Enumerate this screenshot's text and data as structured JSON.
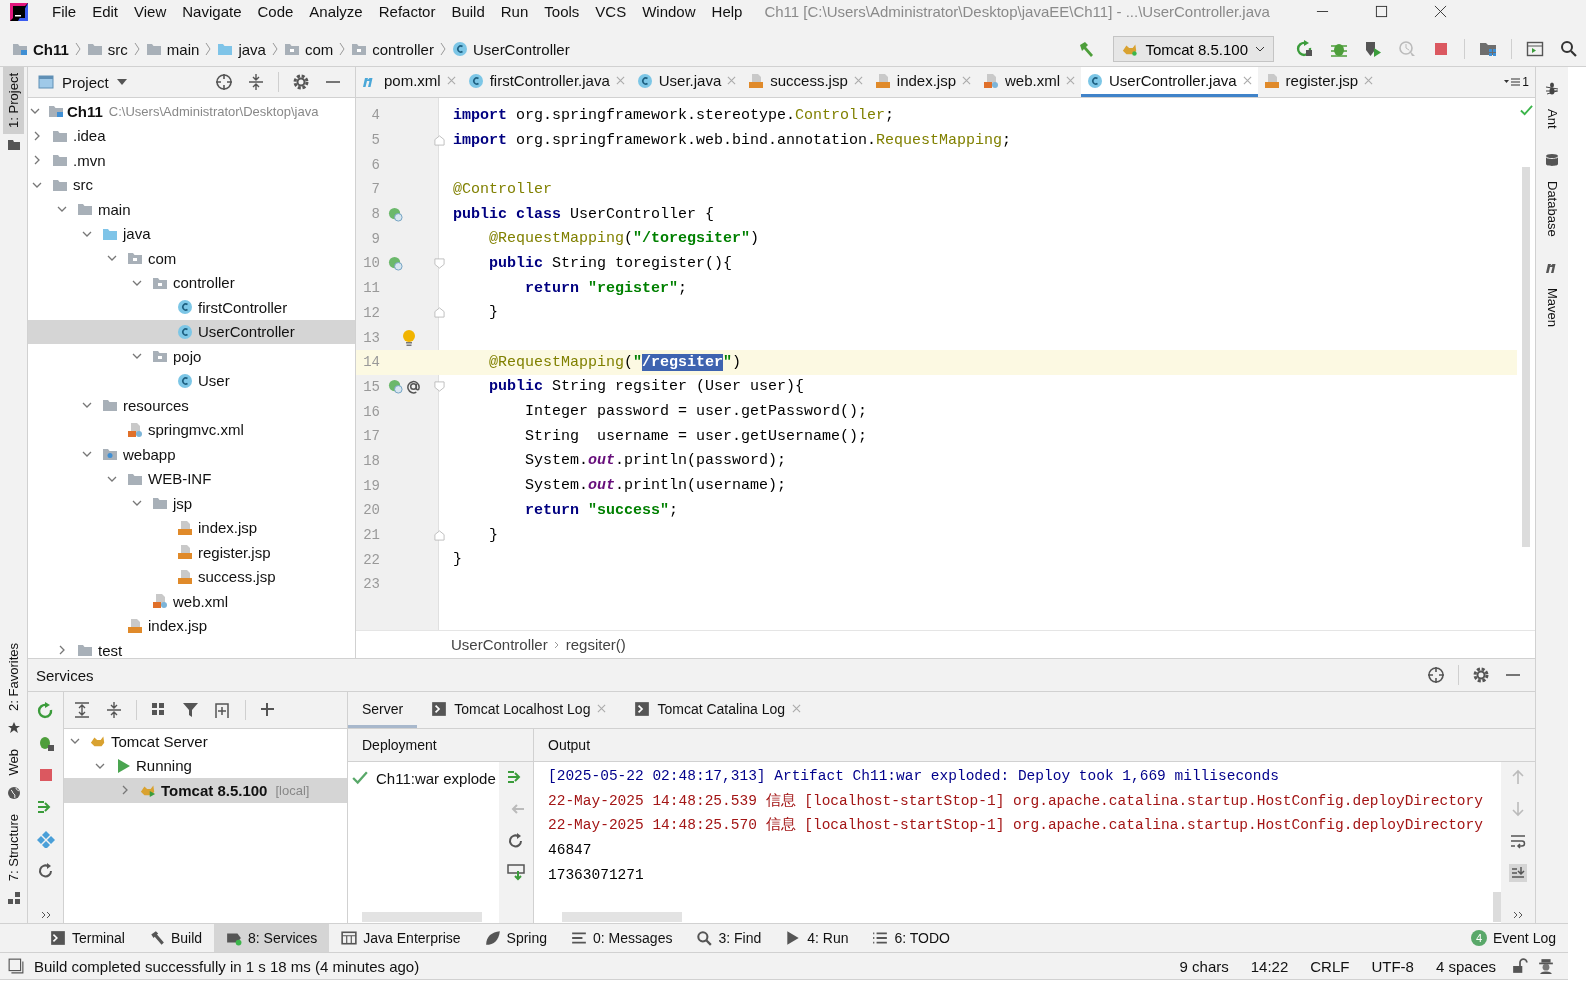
{
  "window": {
    "title": "Ch11 [C:\\Users\\Administrator\\Desktop\\javaEE\\Ch11] - ...\\UserController.java"
  },
  "menu": [
    "File",
    "Edit",
    "View",
    "Navigate",
    "Code",
    "Analyze",
    "Refactor",
    "Build",
    "Run",
    "Tools",
    "VCS",
    "Window",
    "Help"
  ],
  "breadcrumb": [
    {
      "label": "Ch11",
      "kind": "module"
    },
    {
      "label": "src",
      "kind": "folder"
    },
    {
      "label": "main",
      "kind": "folder"
    },
    {
      "label": "java",
      "kind": "srcfolder"
    },
    {
      "label": "com",
      "kind": "pkg"
    },
    {
      "label": "controller",
      "kind": "pkg"
    },
    {
      "label": "UserController",
      "kind": "class"
    }
  ],
  "run_config": {
    "label": "Tomcat 8.5.100"
  },
  "left_strip": [
    {
      "label": "1: Project",
      "selected": true
    },
    {
      "label": "2: Favorites",
      "selected": false
    },
    {
      "label": "Web",
      "selected": false
    },
    {
      "label": "7: Structure",
      "selected": false
    }
  ],
  "right_strip": [
    "Ant",
    "Database",
    "Maven"
  ],
  "project": {
    "title": "Project",
    "tree": [
      {
        "label": "Ch11",
        "kind": "module",
        "path": "C:\\Users\\Administrator\\Desktop\\java",
        "expanded": true,
        "selected": false,
        "children": [
          {
            "label": ".idea",
            "kind": "folder",
            "expanded": false,
            "selected": false
          },
          {
            "label": ".mvn",
            "kind": "folder",
            "expanded": false,
            "selected": false
          },
          {
            "label": "src",
            "kind": "folder",
            "expanded": true,
            "selected": false,
            "children": [
              {
                "label": "main",
                "kind": "folder",
                "expanded": true,
                "selected": false,
                "children": [
                  {
                    "label": "java",
                    "kind": "srcfolder",
                    "expanded": true,
                    "selected": false,
                    "children": [
                      {
                        "label": "com",
                        "kind": "pkg",
                        "expanded": true,
                        "selected": false,
                        "children": [
                          {
                            "label": "controller",
                            "kind": "pkg",
                            "expanded": true,
                            "selected": false,
                            "children": [
                              {
                                "label": "firstController",
                                "kind": "class",
                                "selected": false
                              },
                              {
                                "label": "UserController",
                                "kind": "class",
                                "selected": true
                              }
                            ]
                          },
                          {
                            "label": "pojo",
                            "kind": "pkg",
                            "expanded": true,
                            "selected": false,
                            "children": [
                              {
                                "label": "User",
                                "kind": "class",
                                "selected": false
                              }
                            ]
                          }
                        ]
                      }
                    ]
                  },
                  {
                    "label": "resources",
                    "kind": "folder",
                    "expanded": true,
                    "selected": false,
                    "children": [
                      {
                        "label": "springmvc.xml",
                        "kind": "xml",
                        "selected": false
                      }
                    ]
                  },
                  {
                    "label": "webapp",
                    "kind": "webfolder",
                    "expanded": true,
                    "selected": false,
                    "children": [
                      {
                        "label": "WEB-INF",
                        "kind": "folder",
                        "expanded": true,
                        "selected": false,
                        "children": [
                          {
                            "label": "jsp",
                            "kind": "folder",
                            "expanded": true,
                            "selected": false,
                            "children": [
                              {
                                "label": "index.jsp",
                                "kind": "jsp",
                                "selected": false
                              },
                              {
                                "label": "register.jsp",
                                "kind": "jsp",
                                "selected": false
                              },
                              {
                                "label": "success.jsp",
                                "kind": "jsp",
                                "selected": false
                              }
                            ]
                          },
                          {
                            "label": "web.xml",
                            "kind": "xml",
                            "selected": false
                          }
                        ]
                      },
                      {
                        "label": "index.jsp",
                        "kind": "jsp",
                        "selected": false
                      }
                    ]
                  }
                ]
              },
              {
                "label": "test",
                "kind": "folder",
                "expanded": false,
                "selected": false
              }
            ]
          }
        ]
      }
    ]
  },
  "editor": {
    "tabs": [
      {
        "label": "pom.xml",
        "kind": "maven",
        "selected": false
      },
      {
        "label": "firstController.java",
        "kind": "class",
        "selected": false
      },
      {
        "label": "User.java",
        "kind": "class",
        "selected": false
      },
      {
        "label": "success.jsp",
        "kind": "jsp",
        "selected": false
      },
      {
        "label": "index.jsp",
        "kind": "jsp",
        "selected": false
      },
      {
        "label": "web.xml",
        "kind": "xml",
        "selected": false
      },
      {
        "label": "UserController.java",
        "kind": "class",
        "selected": true
      },
      {
        "label": "register.jsp",
        "kind": "jsp",
        "selected": false
      }
    ],
    "tab_overflow": "1",
    "lines": [
      {
        "n": "4",
        "current": false,
        "tokens": [
          {
            "kind": "kw",
            "text": "import"
          },
          {
            "kind": "p",
            "text": " org.springframework.stereotype."
          },
          {
            "kind": "type",
            "text": "Controller"
          },
          {
            "kind": "p",
            "text": ";"
          }
        ]
      },
      {
        "n": "5",
        "current": false,
        "fold_end": true,
        "tokens": [
          {
            "kind": "kw",
            "text": "import"
          },
          {
            "kind": "p",
            "text": " org.springframework.web.bind.annotation."
          },
          {
            "kind": "type",
            "text": "RequestMapping"
          },
          {
            "kind": "p",
            "text": ";"
          }
        ]
      },
      {
        "n": "6",
        "current": false
      },
      {
        "n": "7",
        "current": false,
        "tokens": [
          {
            "kind": "ann",
            "text": "@Controller"
          }
        ]
      },
      {
        "n": "8",
        "current": false,
        "gutter": [
          {
            "kind": "bean"
          }
        ],
        "tokens": [
          {
            "kind": "kw",
            "text": "public class"
          },
          {
            "kind": "p",
            "text": " UserController {"
          }
        ]
      },
      {
        "n": "9",
        "current": false,
        "tokens": [
          {
            "kind": "ann",
            "text": "    @RequestMapping"
          },
          {
            "kind": "p",
            "text": "("
          },
          {
            "kind": "str",
            "text": "\"/toregsiter\""
          },
          {
            "kind": "p",
            "text": ")"
          }
        ]
      },
      {
        "n": "10",
        "current": false,
        "gutter": [
          {
            "kind": "bean"
          }
        ],
        "fold_start": true,
        "tokens": [
          {
            "kind": "kw",
            "text": "    public"
          },
          {
            "kind": "p",
            "text": " String toregister(){"
          }
        ]
      },
      {
        "n": "11",
        "current": false,
        "tokens": [
          {
            "kind": "kw",
            "text": "        return"
          },
          {
            "kind": "str",
            "text": " \"register\""
          },
          {
            "kind": "p",
            "text": ";"
          }
        ]
      },
      {
        "n": "12",
        "current": false,
        "fold_end": true,
        "tokens": [
          {
            "kind": "p",
            "text": "    }"
          }
        ]
      },
      {
        "n": "13",
        "current": false,
        "bulb": true
      },
      {
        "n": "14",
        "current": true,
        "tokens": [
          {
            "kind": "ann",
            "text": "    @RequestMapping"
          },
          {
            "kind": "p",
            "text": "("
          },
          {
            "kind": "str",
            "text": "\""
          },
          {
            "kind": "sel",
            "text": "/regsiter"
          },
          {
            "kind": "str",
            "text": "\""
          },
          {
            "kind": "p",
            "text": ")"
          }
        ]
      },
      {
        "n": "15",
        "current": false,
        "gutter": [
          {
            "kind": "bean"
          },
          {
            "kind": "at"
          }
        ],
        "fold_start": true,
        "tokens": [
          {
            "kind": "kw",
            "text": "    public"
          },
          {
            "kind": "p",
            "text": " String regsiter (User user){"
          }
        ]
      },
      {
        "n": "16",
        "current": false,
        "tokens": [
          {
            "kind": "p",
            "text": "        Integer password = user.getPassword();"
          }
        ]
      },
      {
        "n": "17",
        "current": false,
        "tokens": [
          {
            "kind": "p",
            "text": "        String  username = user.getUsername();"
          }
        ]
      },
      {
        "n": "18",
        "current": false,
        "tokens": [
          {
            "kind": "p",
            "text": "        System."
          },
          {
            "kind": "out",
            "text": "out"
          },
          {
            "kind": "p",
            "text": ".println(password);"
          }
        ]
      },
      {
        "n": "19",
        "current": false,
        "tokens": [
          {
            "kind": "p",
            "text": "        System."
          },
          {
            "kind": "out",
            "text": "out"
          },
          {
            "kind": "p",
            "text": ".println(username);"
          }
        ]
      },
      {
        "n": "20",
        "current": false,
        "tokens": [
          {
            "kind": "kw",
            "text": "        return"
          },
          {
            "kind": "str",
            "text": " \"success\""
          },
          {
            "kind": "p",
            "text": ";"
          }
        ]
      },
      {
        "n": "21",
        "current": false,
        "fold_end": true,
        "tokens": [
          {
            "kind": "p",
            "text": "    }"
          }
        ]
      },
      {
        "n": "22",
        "current": false,
        "tokens": [
          {
            "kind": "p",
            "text": "}"
          }
        ]
      },
      {
        "n": "23",
        "current": false
      }
    ],
    "crumbs": [
      "UserController",
      "regsiter()"
    ]
  },
  "services": {
    "title": "Services",
    "tree": [
      {
        "label": "Tomcat Server",
        "kind": "tomcat",
        "expanded": true,
        "selected": false,
        "children": [
          {
            "label": "Running",
            "kind": "running",
            "expanded": true,
            "selected": false,
            "children": [
              {
                "label": "Tomcat 8.5.100",
                "suffix": "[local]",
                "kind": "tomcat-run",
                "expanded": false,
                "selected": true
              }
            ]
          }
        ]
      }
    ],
    "tabs": [
      {
        "label": "Server",
        "closable": false,
        "selected": true
      },
      {
        "label": "Tomcat Localhost Log",
        "closable": true,
        "selected": false
      },
      {
        "label": "Tomcat Catalina Log",
        "closable": true,
        "selected": false
      }
    ],
    "deployment": {
      "title": "Deployment",
      "items": [
        "Ch11:war explode"
      ]
    },
    "output": {
      "title": "Output",
      "lines": [
        {
          "kind": "info",
          "text": "[2025-05-22 02:48:17,313] Artifact Ch11:war exploded: Deploy took 1,669 milliseconds"
        },
        {
          "kind": "err",
          "text": "22-May-2025 14:48:25.539 信息 [localhost-startStop-1] org.apache.catalina.startup.HostConfig.deployDirectory"
        },
        {
          "kind": "err",
          "text": "22-May-2025 14:48:25.570 信息 [localhost-startStop-1] org.apache.catalina.startup.HostConfig.deployDirectory"
        },
        {
          "kind": "plain",
          "text": "46847"
        },
        {
          "kind": "plain",
          "text": "17363071271"
        }
      ]
    }
  },
  "tool_tabs": [
    {
      "label": "Terminal",
      "kind": "terminal",
      "selected": false
    },
    {
      "label": "Build",
      "kind": "build",
      "selected": false
    },
    {
      "label": "8: Services",
      "kind": "services",
      "selected": true
    },
    {
      "label": "Java Enterprise",
      "kind": "enterprise",
      "selected": false
    },
    {
      "label": "Spring",
      "kind": "spring",
      "selected": false
    },
    {
      "label": "0: Messages",
      "kind": "messages",
      "selected": false
    },
    {
      "label": "3: Find",
      "kind": "find",
      "selected": false
    },
    {
      "label": "4: Run",
      "kind": "run",
      "selected": false
    },
    {
      "label": "6: TODO",
      "kind": "todo",
      "selected": false
    }
  ],
  "event_log": {
    "label": "Event Log",
    "count": "4"
  },
  "status_bar": {
    "message": "Build completed successfully in 1 s 18 ms (4 minutes ago)",
    "items": [
      "9 chars",
      "14:22",
      "CRLF",
      "UTF-8",
      "4 spaces"
    ]
  }
}
